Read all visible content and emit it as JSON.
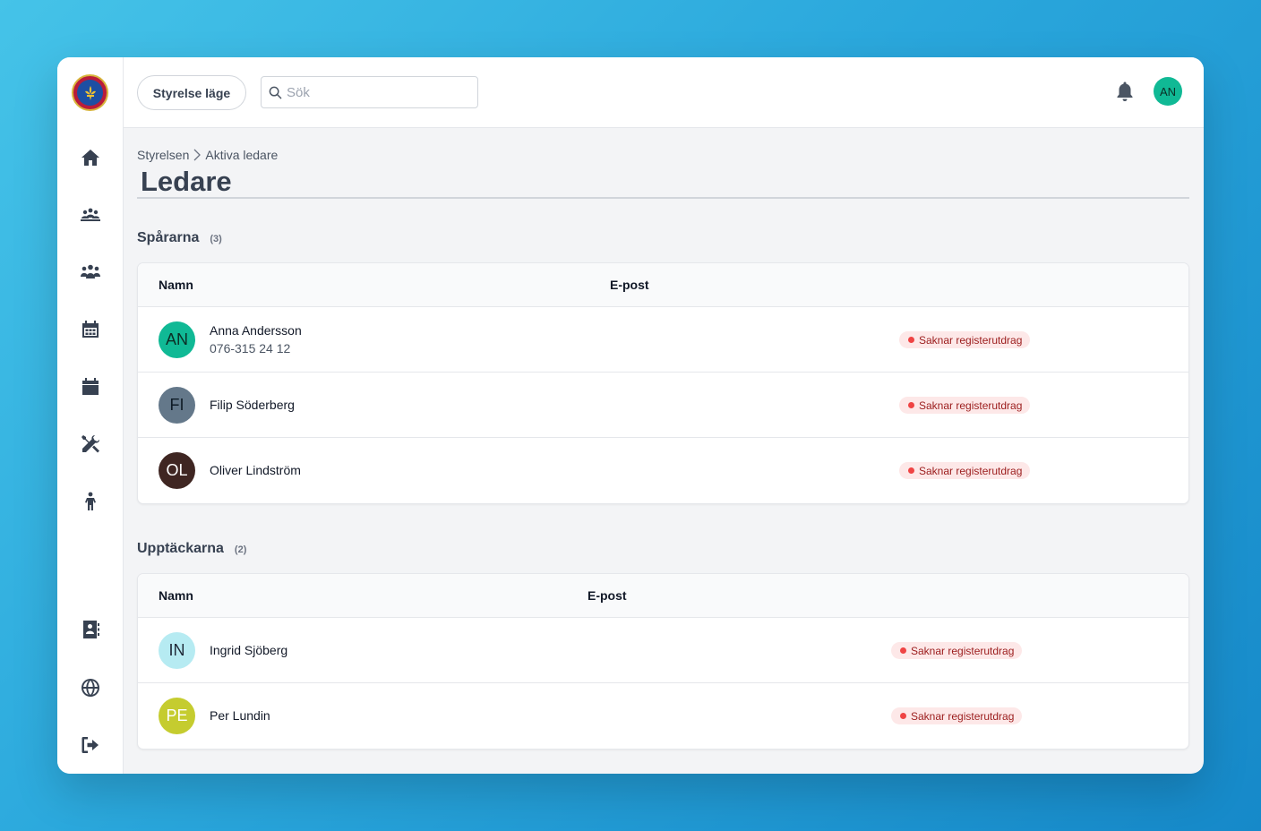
{
  "colors": {
    "accent_teal": "#10b995",
    "badge_bg": "#fde8e8",
    "badge_text": "#9b1c1c",
    "badge_dot": "#ef4444"
  },
  "sidebar": {
    "logo_icon": "scout-emblem",
    "items": [
      {
        "icon": "home-icon"
      },
      {
        "icon": "group-meeting-icon"
      },
      {
        "icon": "people-icon"
      },
      {
        "icon": "calendar-grid-icon"
      },
      {
        "icon": "calendar-icon"
      },
      {
        "icon": "tools-icon"
      },
      {
        "icon": "child-icon"
      }
    ],
    "bottom_items": [
      {
        "icon": "contact-book-icon"
      },
      {
        "icon": "globe-icon"
      },
      {
        "icon": "logout-icon"
      }
    ]
  },
  "topbar": {
    "mode_button": "Styrelse läge",
    "search": {
      "placeholder": "Sök",
      "value": ""
    },
    "notification_icon": "bell-icon",
    "user_initials": "AN"
  },
  "breadcrumb": {
    "parent": "Styrelsen",
    "current": "Aktiva ledare"
  },
  "page_title": "Ledare",
  "groups": [
    {
      "name": "Spårarna",
      "count": "(3)",
      "columns": {
        "name": "Namn",
        "email": "E-post"
      },
      "members": [
        {
          "initials": "AN",
          "name": "Anna Andersson",
          "phone": "076-315 24 12",
          "status": "Saknar registerutdrag",
          "avatar_color": "#10b995",
          "avatar_text_color": "#0b2e25"
        },
        {
          "initials": "FI",
          "name": "Filip Söderberg",
          "phone": "",
          "status": "Saknar registerutdrag",
          "avatar_color": "#64788a",
          "avatar_text_color": "#0f1b26"
        },
        {
          "initials": "OL",
          "name": "Oliver Lindström",
          "phone": "",
          "status": "Saknar registerutdrag",
          "avatar_color": "#3f2622",
          "avatar_text_color": "#ffffff"
        }
      ]
    },
    {
      "name": "Upptäckarna",
      "count": "(2)",
      "columns": {
        "name": "Namn",
        "email": "E-post"
      },
      "members": [
        {
          "initials": "IN",
          "name": "Ingrid Sjöberg",
          "phone": "",
          "status": "Saknar registerutdrag",
          "avatar_color": "#b6ebf2",
          "avatar_text_color": "#1f2937"
        },
        {
          "initials": "PE",
          "name": "Per Lundin",
          "phone": "",
          "status": "Saknar registerutdrag",
          "avatar_color": "#c5cc2f",
          "avatar_text_color": "#ffffff"
        }
      ]
    }
  ]
}
